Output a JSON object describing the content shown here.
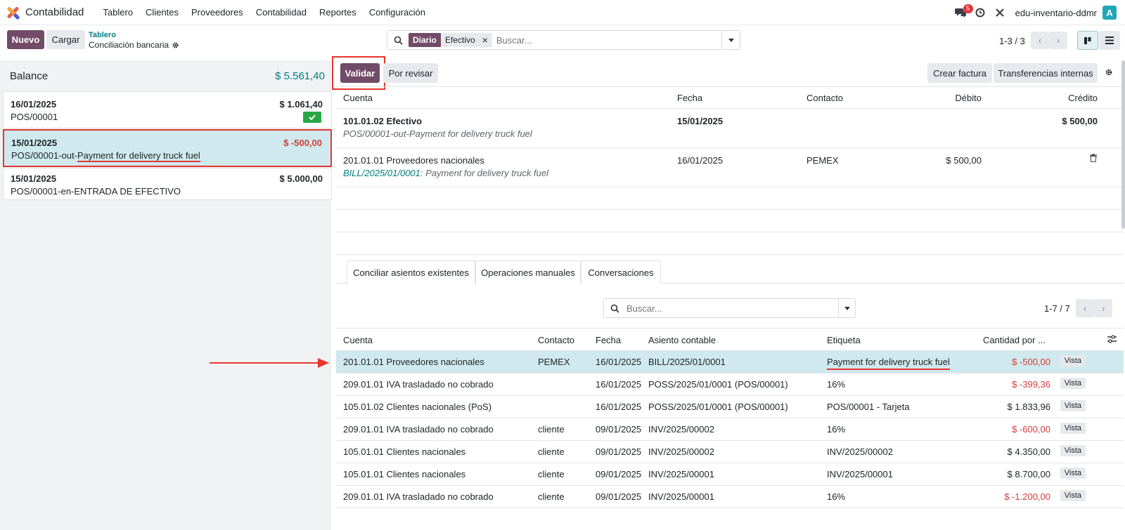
{
  "navbar": {
    "app_name": "Contabilidad",
    "menu": [
      "Tablero",
      "Clientes",
      "Proveedores",
      "Contabilidad",
      "Reportes",
      "Configuración"
    ],
    "chat_count": "5",
    "company": "edu-inventario-ddmr",
    "avatar_letter": "A"
  },
  "control": {
    "new_label": "Nuevo",
    "upload_label": "Cargar",
    "breadcrumb_parent": "Tablero",
    "breadcrumb_current": "Conciliación bancaria",
    "facet_key": "Diario",
    "facet_value": "Efectivo",
    "search_placeholder": "Buscar...",
    "pager": "1-3 / 3"
  },
  "left": {
    "balance_label": "Balance",
    "balance_value": "$ 5.561,40",
    "lines": [
      {
        "date": "16/01/2025",
        "ref": "POS/00001",
        "amount": "$ 1.061,40"
      },
      {
        "date": "15/01/2025",
        "ref_prefix": "POS/00001-out-",
        "ref_label": "Payment for delivery truck fuel",
        "amount": "$ -500,00"
      },
      {
        "date": "15/01/2025",
        "ref": "POS/00001-en-ENTRADA DE EFECTIVO",
        "amount": "$ 5.000,00"
      }
    ]
  },
  "actions": {
    "validate": "Validar",
    "to_review": "Por revisar",
    "create_invoice": "Crear factura",
    "internal_transfers": "Transferencias internas"
  },
  "entries": {
    "headers": [
      "Cuenta",
      "Fecha",
      "Contacto",
      "Débito",
      "Crédito"
    ],
    "rows": [
      {
        "account": "101.01.02 Efectivo",
        "date": "15/01/2025",
        "contact": "",
        "debit": "",
        "credit": "$ 500,00",
        "label": "POS/00001-out-Payment for delivery truck fuel"
      },
      {
        "account": "201.01.01 Proveedores nacionales",
        "date": "16/01/2025",
        "contact": "PEMEX",
        "debit": "$ 500,00",
        "credit": "",
        "label_link": "BILL/2025/01/0001",
        "label_rest": ": Payment for delivery truck fuel"
      }
    ]
  },
  "tabs": [
    "Conciliar asientos existentes",
    "Operaciones manuales",
    "Conversaciones"
  ],
  "reconcile": {
    "search_placeholder": "Buscar...",
    "pager": "1-7 / 7",
    "headers": [
      "Cuenta",
      "Contacto",
      "Fecha",
      "Asiento contable",
      "Etiqueta",
      "Cantidad por ..."
    ],
    "view_label": "Vista",
    "rows": [
      {
        "account": "201.01.01 Proveedores nacionales",
        "contact": "PEMEX",
        "date": "16/01/2025",
        "move": "BILL/2025/01/0001",
        "label": "Payment for delivery truck fuel",
        "amount": "$ -500,00",
        "negative": true
      },
      {
        "account": "209.01.01 IVA trasladado no cobrado",
        "contact": "",
        "date": "16/01/2025",
        "move": "POSS/2025/01/0001 (POS/00001)",
        "label": "16%",
        "amount": "$ -399,36",
        "negative": true
      },
      {
        "account": "105.01.02 Clientes nacionales (PoS)",
        "contact": "",
        "date": "16/01/2025",
        "move": "POSS/2025/01/0001 (POS/00001)",
        "label": "POS/00001 - Tarjeta",
        "amount": "$ 1.833,96",
        "negative": false
      },
      {
        "account": "209.01.01 IVA trasladado no cobrado",
        "contact": "cliente",
        "date": "09/01/2025",
        "move": "INV/2025/00002",
        "label": "16%",
        "amount": "$ -600,00",
        "negative": true
      },
      {
        "account": "105.01.01 Clientes nacionales",
        "contact": "cliente",
        "date": "09/01/2025",
        "move": "INV/2025/00002",
        "label": "INV/2025/00002",
        "amount": "$ 4.350,00",
        "negative": false
      },
      {
        "account": "105.01.01 Clientes nacionales",
        "contact": "cliente",
        "date": "09/01/2025",
        "move": "INV/2025/00001",
        "label": "INV/2025/00001",
        "amount": "$ 8.700,00",
        "negative": false
      },
      {
        "account": "209.01.01 IVA trasladado no cobrado",
        "contact": "cliente",
        "date": "09/01/2025",
        "move": "INV/2025/00001",
        "label": "16%",
        "amount": "$ -1.200,00",
        "negative": true
      }
    ]
  },
  "colors": {
    "brand": "#714b67",
    "accent_teal": "#017e84",
    "highlight_row": "#cfe9ee",
    "negative": "#d23f3a",
    "annotation_red": "#e5362f"
  }
}
